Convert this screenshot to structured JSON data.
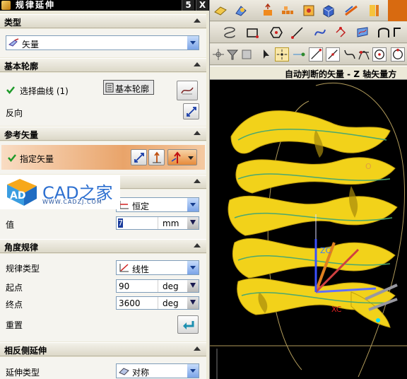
{
  "dialog": {
    "title": "规律延伸",
    "title_buttons": [
      "5",
      "X"
    ],
    "sections": {
      "type": {
        "label": "类型",
        "dropdown_value": "矢量"
      },
      "base_profile": {
        "label": "基本轮廓",
        "select_curve": "选择曲线 (1)",
        "reverse": "反向"
      },
      "ref_vector": {
        "label": "参考矢量",
        "specify_vector": "指定矢量"
      },
      "length_law": {
        "law_type_value": "恒定",
        "value_label": "值",
        "value": "7",
        "value_unit": "mm"
      },
      "angle_law": {
        "label": "角度规律",
        "law_type_label": "规律类型",
        "law_type_value": "线性",
        "start_label": "起点",
        "start_value": "90",
        "start_unit": "deg",
        "end_label": "终点",
        "end_value": "3600",
        "end_unit": "deg",
        "reset_label": "重置"
      },
      "opposite_side": {
        "label": "相反侧延伸",
        "extend_type_label": "延伸类型",
        "extend_type_value": "对称"
      }
    }
  },
  "watermark": {
    "logo_text": "CAD之家",
    "logo_mark": "AD",
    "url": "WWW.CADZJ.COM"
  },
  "status_text": "自动判断的矢量 - Z 轴矢量方",
  "tooltip": "基本轮廓",
  "viewport": {
    "axis_labels": {
      "zc": "ZC",
      "xc": "XC",
      "o_label": "O"
    }
  },
  "colors": {
    "accent_blue": "#2c6fd0",
    "highlight_orange": "#e9a46a",
    "surface_yellow": "#f2d21a",
    "check_green": "#1f9a2a"
  },
  "icons": [
    "vector-icon",
    "curve-icon",
    "reverse-icon",
    "specify-vector-icon",
    "reset-icon",
    "constant-law-icon",
    "linear-law-icon",
    "symmetric-icon"
  ]
}
